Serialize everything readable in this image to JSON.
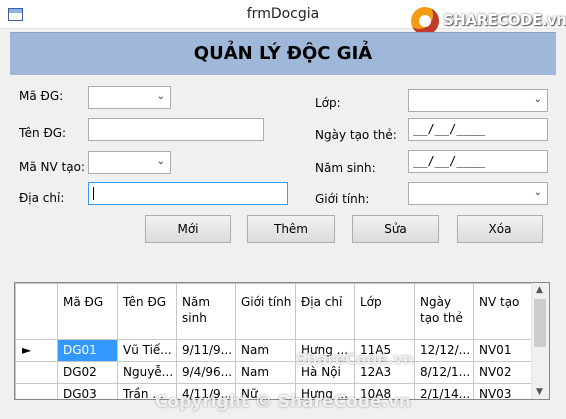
{
  "window": {
    "title": "frmDocgia"
  },
  "logo": {
    "text": "SHARECODE.vn"
  },
  "header": {
    "title": "QUẢN LÝ ĐỘC GIẢ"
  },
  "form": {
    "ma_dg_label": "Mã ĐG:",
    "ten_dg_label": "Tên ĐG:",
    "ma_nv_label": "Mã NV tạo:",
    "dia_chi_label": "Địa chỉ:",
    "lop_label": "Lớp:",
    "ngay_tao_label": "Ngày tạo thẻ:",
    "nam_sinh_label": "Năm sinh:",
    "gioi_tinh_label": "Giới tính:",
    "ma_dg_value": "",
    "ten_dg_value": "",
    "ma_nv_value": "",
    "dia_chi_value": "",
    "lop_value": "",
    "ngay_tao_mask": "__/__/____",
    "nam_sinh_mask": "__/__/____",
    "gioi_tinh_value": ""
  },
  "buttons": {
    "moi": "Mới",
    "them": "Thêm",
    "sua": "Sửa",
    "xoa": "Xóa"
  },
  "grid": {
    "columns": [
      "Mã ĐG",
      "Tên ĐG",
      "Năm sinh",
      "Giới tính",
      "Địa chỉ",
      "Lớp",
      "Ngày tạo thẻ",
      "NV tạo"
    ],
    "rows": [
      [
        "DG01",
        "Vũ Tiế...",
        "9/11/9...",
        "Nam",
        "Hưng ...",
        "11A5",
        "12/12/...",
        "NV01"
      ],
      [
        "DG02",
        "Nguyễ...",
        "9/4/96...",
        "Nam",
        "Hà Nội",
        "12A3",
        "8/12/1...",
        "NV02"
      ],
      [
        "DG03",
        "Trần ...",
        "4/11/9...",
        "Nữ",
        "Hưng ...",
        "10A8",
        "2/1/14...",
        "NV03"
      ]
    ],
    "current_row_indicator": "►"
  },
  "watermarks": {
    "center": "ShareCode.vn",
    "bottom": "Copyright © ShareCode.vn"
  }
}
